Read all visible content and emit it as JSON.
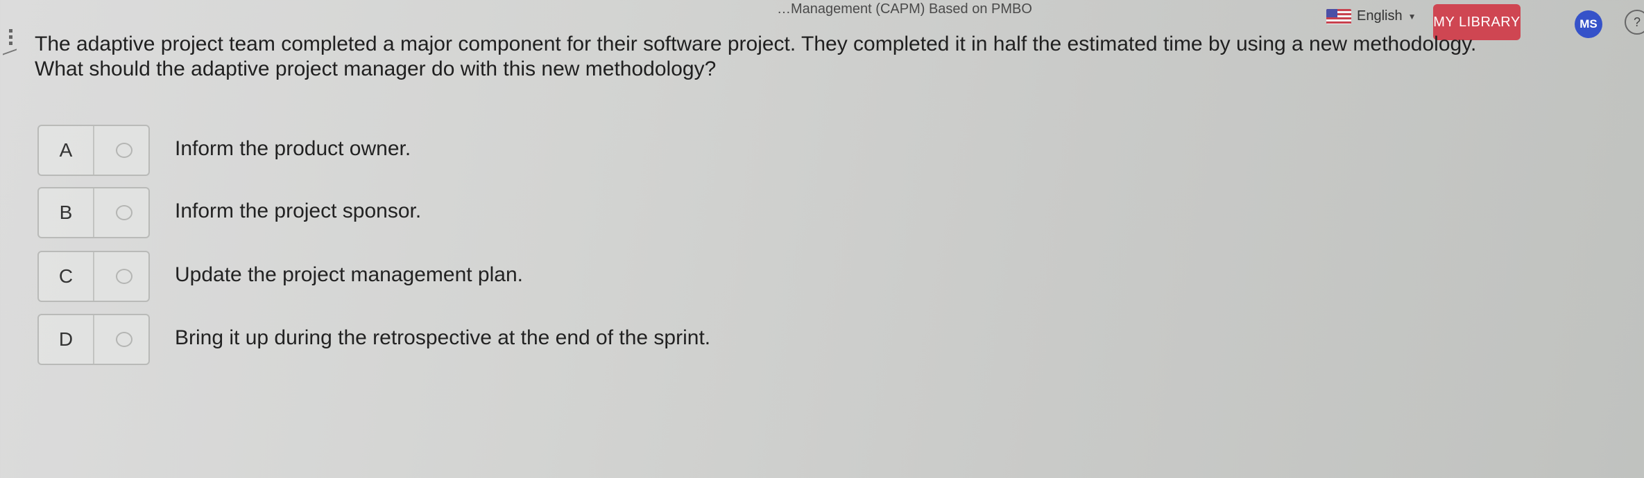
{
  "header": {
    "title": "…Management (CAPM) Based on PMBO",
    "language": "English",
    "library_label": "MY LIBRARY",
    "avatar_initials": "MS",
    "help_label": "?"
  },
  "question": {
    "line1": "The adaptive project team completed a major component for their software project. They completed it in half the estimated time by using a new methodology.",
    "line2": "What should the adaptive project manager do with this new methodology?"
  },
  "options": [
    {
      "letter": "A",
      "text": "Inform the product owner."
    },
    {
      "letter": "B",
      "text": "Inform the project sponsor."
    },
    {
      "letter": "C",
      "text": "Update the project management plan."
    },
    {
      "letter": "D",
      "text": "Bring it up during the retrospective at the end of the sprint."
    }
  ],
  "colors": {
    "library_button": "#cf4652",
    "avatar": "#3552c9"
  }
}
